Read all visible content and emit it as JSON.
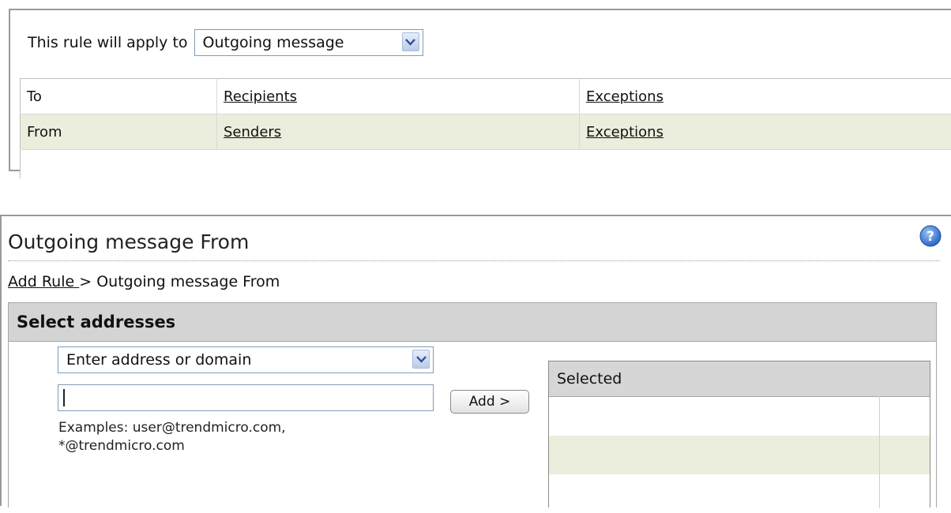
{
  "rule_panel": {
    "apply_label": "This rule will apply to",
    "apply_select_value": "Outgoing message",
    "rows": [
      {
        "direction": "To",
        "target": "Recipients",
        "exceptions": "Exceptions"
      },
      {
        "direction": "From",
        "target": "Senders",
        "exceptions": "Exceptions"
      }
    ]
  },
  "dialog": {
    "title": "Outgoing message From",
    "breadcrumb": {
      "link": "Add Rule ",
      "current": "> Outgoing message From"
    },
    "section_title": "Select addresses",
    "address_type_select": "Enter address or domain",
    "address_input_value": "",
    "examples_line1": "Examples: user@trendmicro.com,",
    "examples_line2": "*@trendmicro.com",
    "add_button": "Add >",
    "selected_header": "Selected"
  },
  "icons": {
    "help": "help-icon",
    "dropdown": "chevron-down-icon"
  },
  "colors": {
    "alt_row": "#eceedd",
    "header_gray": "#d4d4d4",
    "help_blue": "#3d7fd6"
  }
}
